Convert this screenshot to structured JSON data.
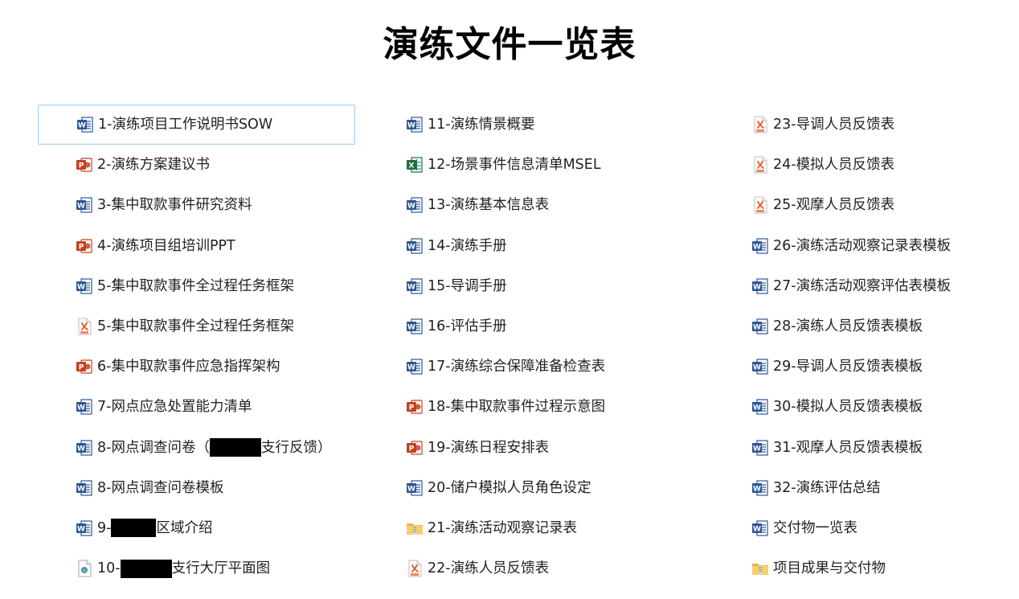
{
  "title": "演练文件一览表",
  "columns": [
    {
      "items": [
        {
          "icon": "word-doc-icon",
          "label": "1-演练项目工作说明书SOW",
          "selected": true
        },
        {
          "icon": "powerpoint-icon",
          "label": "2-演练方案建议书"
        },
        {
          "icon": "word-doc-icon",
          "label": "3-集中取款事件研究资料"
        },
        {
          "icon": "powerpoint-icon",
          "label": "4-演练项目组培训PPT"
        },
        {
          "icon": "word-doc-icon",
          "label": "5-集中取款事件全过程任务框架"
        },
        {
          "icon": "pdf-icon",
          "label": "5-集中取款事件全过程任务框架"
        },
        {
          "icon": "powerpoint-icon",
          "label": "6-集中取款事件应急指挥架构"
        },
        {
          "icon": "word-doc-icon",
          "label": "7-网点应急处置能力清单"
        },
        {
          "icon": "word-doc-icon",
          "label_before": "8-网点调查问卷（",
          "label_after": "支行反馈）"
        },
        {
          "icon": "word-doc-icon",
          "label": "8-网点调查问卷模板"
        },
        {
          "icon": "word-doc-icon",
          "label_before": "9-",
          "label_after": "区域介绍"
        },
        {
          "icon": "image-file-icon",
          "label_before": "10-",
          "label_after": "支行大厅平面图"
        }
      ]
    },
    {
      "items": [
        {
          "icon": "word-doc-icon",
          "label": "11-演练情景概要"
        },
        {
          "icon": "excel-icon",
          "label": "12-场景事件信息清单MSEL"
        },
        {
          "icon": "word-doc-icon",
          "label": "13-演练基本信息表"
        },
        {
          "icon": "word-doc-icon",
          "label": "14-演练手册"
        },
        {
          "icon": "word-doc-icon",
          "label": "15-导调手册"
        },
        {
          "icon": "word-doc-icon",
          "label": "16-评估手册"
        },
        {
          "icon": "word-doc-icon",
          "label": "17-演练综合保障准备检查表"
        },
        {
          "icon": "powerpoint-icon",
          "label": "18-集中取款事件过程示意图"
        },
        {
          "icon": "powerpoint-icon",
          "label": "19-演练日程安排表"
        },
        {
          "icon": "word-doc-icon",
          "label": "20-储户模拟人员角色设定"
        },
        {
          "icon": "zip-folder-icon",
          "label": "21-演练活动观察记录表"
        },
        {
          "icon": "pdf-icon",
          "label": "22-演练人员反馈表"
        }
      ]
    },
    {
      "items": [
        {
          "icon": "pdf-icon",
          "label": "23-导调人员反馈表"
        },
        {
          "icon": "pdf-icon",
          "label": "24-模拟人员反馈表"
        },
        {
          "icon": "pdf-icon",
          "label": "25-观摩人员反馈表"
        },
        {
          "icon": "word-doc-icon",
          "label": "26-演练活动观察记录表模板"
        },
        {
          "icon": "word-doc-icon",
          "label": "27-演练活动观察评估表模板"
        },
        {
          "icon": "word-doc-icon",
          "label": "28-演练人员反馈表模板"
        },
        {
          "icon": "word-doc-icon",
          "label": "29-导调人员反馈表模板"
        },
        {
          "icon": "word-doc-icon",
          "label": "30-模拟人员反馈表模板"
        },
        {
          "icon": "word-doc-icon",
          "label": "31-观摩人员反馈表模板"
        },
        {
          "icon": "word-doc-icon",
          "label": "32-演练评估总结"
        },
        {
          "icon": "word-doc-icon",
          "label": "交付物一览表"
        },
        {
          "icon": "zip-folder-icon",
          "label": "项目成果与交付物"
        }
      ]
    }
  ],
  "colors": {
    "word": "#2b5797",
    "powerpoint": "#c9401f",
    "excel": "#1d7044",
    "pdf": "#e8541e",
    "folder": "#e9b64a",
    "selection_border": "#a9d2f5"
  }
}
